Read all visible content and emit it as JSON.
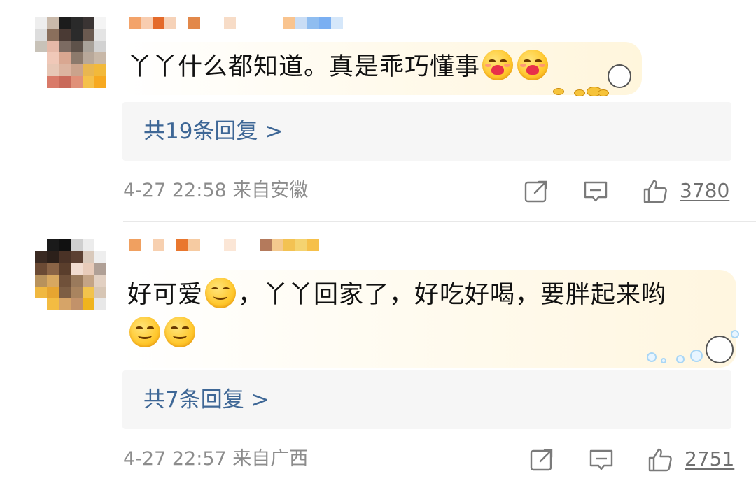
{
  "comments": [
    {
      "text": "丫丫什么都知道。真是乖巧懂事",
      "emojis": [
        "hug-emoji",
        "hug-emoji"
      ],
      "replies_label": "共19条回复 >",
      "timestamp": "4-27 22:58",
      "location": "来自安徽",
      "likes": "3780"
    },
    {
      "text": "好可爱",
      "text_after_emoji": "，丫丫回家了，好吃好喝，要胖起来哟",
      "emojis": [
        "smile-emoji",
        "smile-emoji",
        "smile-emoji"
      ],
      "replies_label": "共7条回复 >",
      "timestamp": "4-27 22:57",
      "location": "来自广西",
      "likes": "2751"
    }
  ],
  "icons": {
    "share": "share-icon",
    "comment": "comment-icon",
    "like": "thumbs-up-icon"
  },
  "colors": {
    "link": "#3e6796",
    "meta": "#8c8c8c",
    "reply_bg": "#f6f6f6"
  }
}
